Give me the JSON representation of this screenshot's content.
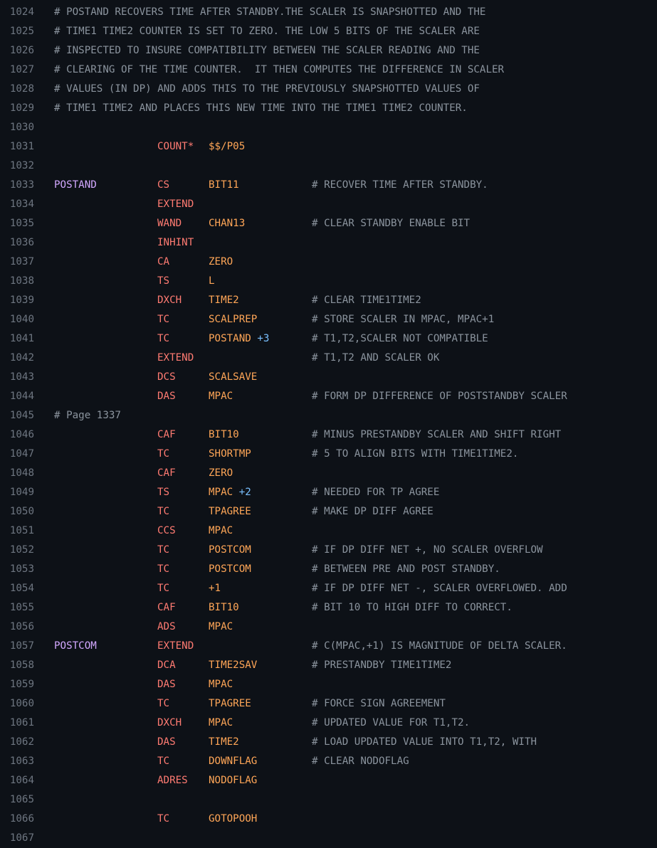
{
  "lines": [
    {
      "n": "1024",
      "full": "# POSTAND RECOVERS TIME AFTER STANDBY.THE SCALER IS SNAPSHOTTED AND THE"
    },
    {
      "n": "1025",
      "full": "# TIME1 TIME2 COUNTER IS SET TO ZERO. THE LOW 5 BITS OF THE SCALER ARE"
    },
    {
      "n": "1026",
      "full": "# INSPECTED TO INSURE COMPATIBILITY BETWEEN THE SCALER READING AND THE"
    },
    {
      "n": "1027",
      "full": "# CLEARING OF THE TIME COUNTER.  IT THEN COMPUTES THE DIFFERENCE IN SCALER"
    },
    {
      "n": "1028",
      "full": "# VALUES (IN DP) AND ADDS THIS TO THE PREVIOUSLY SNAPSHOTTED VALUES OF"
    },
    {
      "n": "1029",
      "full": "# TIME1 TIME2 AND PLACES THIS NEW TIME INTO THE TIME1 TIME2 COUNTER."
    },
    {
      "n": "1030"
    },
    {
      "n": "1031",
      "op": "COUNT*",
      "opd": "$$/P05"
    },
    {
      "n": "1032"
    },
    {
      "n": "1033",
      "label": "POSTAND",
      "op": "CS",
      "opd": "BIT11",
      "cmt": "# RECOVER TIME AFTER STANDBY."
    },
    {
      "n": "1034",
      "op": "EXTEND"
    },
    {
      "n": "1035",
      "op": "WAND",
      "opd": "CHAN13",
      "cmt": "# CLEAR STANDBY ENABLE BIT"
    },
    {
      "n": "1036",
      "op": "INHINT"
    },
    {
      "n": "1037",
      "op": "CA",
      "opd": "ZERO"
    },
    {
      "n": "1038",
      "op": "TS",
      "opd": "L"
    },
    {
      "n": "1039",
      "op": "DXCH",
      "opd": "TIME2",
      "cmt": "# CLEAR TIME1TIME2"
    },
    {
      "n": "1040",
      "op": "TC",
      "opd": "SCALPREP",
      "cmt": "# STORE SCALER IN MPAC, MPAC+1"
    },
    {
      "n": "1041",
      "op": "TC",
      "opd": "POSTAND",
      "num": "+3",
      "cmt": "# T1,T2,SCALER NOT COMPATIBLE"
    },
    {
      "n": "1042",
      "op": "EXTEND",
      "cmt": "# T1,T2 AND SCALER OK"
    },
    {
      "n": "1043",
      "op": "DCS",
      "opd": "SCALSAVE"
    },
    {
      "n": "1044",
      "op": "DAS",
      "opd": "MPAC",
      "cmt": "# FORM DP DIFFERENCE OF POSTSTANDBY SCALER"
    },
    {
      "n": "1045",
      "full": "# Page 1337"
    },
    {
      "n": "1046",
      "op": "CAF",
      "opd": "BIT10",
      "cmt": "# MINUS PRESTANDBY SCALER AND SHIFT RIGHT"
    },
    {
      "n": "1047",
      "op": "TC",
      "opd": "SHORTMP",
      "cmt": "# 5 TO ALIGN BITS WITH TIME1TIME2."
    },
    {
      "n": "1048",
      "op": "CAF",
      "opd": "ZERO"
    },
    {
      "n": "1049",
      "op": "TS",
      "opd": "MPAC",
      "num": "+2",
      "cmt": "# NEEDED FOR TP AGREE"
    },
    {
      "n": "1050",
      "op": "TC",
      "opd": "TPAGREE",
      "cmt": "# MAKE DP DIFF AGREE"
    },
    {
      "n": "1051",
      "op": "CCS",
      "opd": "MPAC"
    },
    {
      "n": "1052",
      "op": "TC",
      "opd": "POSTCOM",
      "cmt": "# IF DP DIFF NET +, NO SCALER OVERFLOW"
    },
    {
      "n": "1053",
      "op": "TC",
      "opd": "POSTCOM",
      "cmt": "# BETWEEN PRE AND POST STANDBY."
    },
    {
      "n": "1054",
      "op": "TC",
      "opd": "+1",
      "cmt": "# IF DP DIFF NET -, SCALER OVERFLOWED. ADD"
    },
    {
      "n": "1055",
      "op": "CAF",
      "opd": "BIT10",
      "cmt": "# BIT 10 TO HIGH DIFF TO CORRECT."
    },
    {
      "n": "1056",
      "op": "ADS",
      "opd": "MPAC"
    },
    {
      "n": "1057",
      "label": "POSTCOM",
      "op": "EXTEND",
      "cmt": "# C(MPAC,+1) IS MAGNITUDE OF DELTA SCALER."
    },
    {
      "n": "1058",
      "op": "DCA",
      "opd": "TIME2SAV",
      "cmt": "# PRESTANDBY TIME1TIME2"
    },
    {
      "n": "1059",
      "op": "DAS",
      "opd": "MPAC"
    },
    {
      "n": "1060",
      "op": "TC",
      "opd": "TPAGREE",
      "cmt": "# FORCE SIGN AGREEMENT"
    },
    {
      "n": "1061",
      "op": "DXCH",
      "opd": "MPAC",
      "cmt": "# UPDATED VALUE FOR T1,T2."
    },
    {
      "n": "1062",
      "op": "DAS",
      "opd": "TIME2",
      "cmt": "# LOAD UPDATED VALUE INTO T1,T2, WITH"
    },
    {
      "n": "1063",
      "op": "TC",
      "opd": "DOWNFLAG",
      "cmt": "# CLEAR NODOFLAG"
    },
    {
      "n": "1064",
      "op": "ADRES",
      "opd": "NODOFLAG"
    },
    {
      "n": "1065"
    },
    {
      "n": "1066",
      "op": "TC",
      "opd": "GOTOPOOH"
    },
    {
      "n": "1067"
    }
  ]
}
